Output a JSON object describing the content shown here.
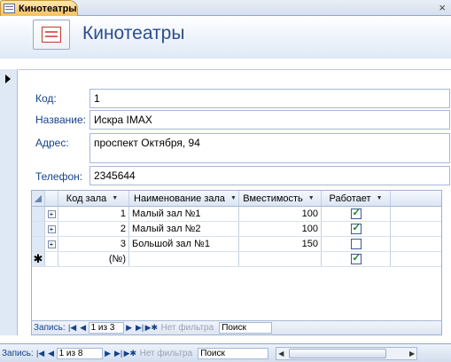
{
  "window": {
    "tab_title": "Кинотеатры",
    "close_glyph": "×"
  },
  "header": {
    "title": "Кинотеатры"
  },
  "form": {
    "code": {
      "label": "Код:",
      "value": "1"
    },
    "name": {
      "label": "Название:",
      "value": "Искра IMAX"
    },
    "address": {
      "label": "Адрес:",
      "value": "проспект Октября, 94"
    },
    "phone": {
      "label": "Телефон:",
      "value": "2345644"
    }
  },
  "subform": {
    "columns": [
      "Код зала",
      "Наименование зала",
      "Вместимость",
      "Работает"
    ],
    "rows": [
      {
        "code": "1",
        "name": "Малый зал №1",
        "capacity": "100",
        "working": true
      },
      {
        "code": "2",
        "name": "Малый зал №2",
        "capacity": "100",
        "working": true
      },
      {
        "code": "3",
        "name": "Большой зал №1",
        "capacity": "150",
        "working": false
      }
    ],
    "new_row": {
      "code": "(№)",
      "working": true
    },
    "nav": {
      "record_label": "Запись:",
      "position": "1 из 3",
      "filter": "Нет фильтра",
      "search": "Поиск"
    }
  },
  "main_nav": {
    "record_label": "Запись:",
    "position": "1 из 8",
    "filter": "Нет фильтра",
    "search": "Поиск"
  },
  "icons": {
    "tab": "form-icon",
    "header": "form-large-icon",
    "expander": "plus-expand-icon",
    "new_record": "asterisk-icon"
  }
}
